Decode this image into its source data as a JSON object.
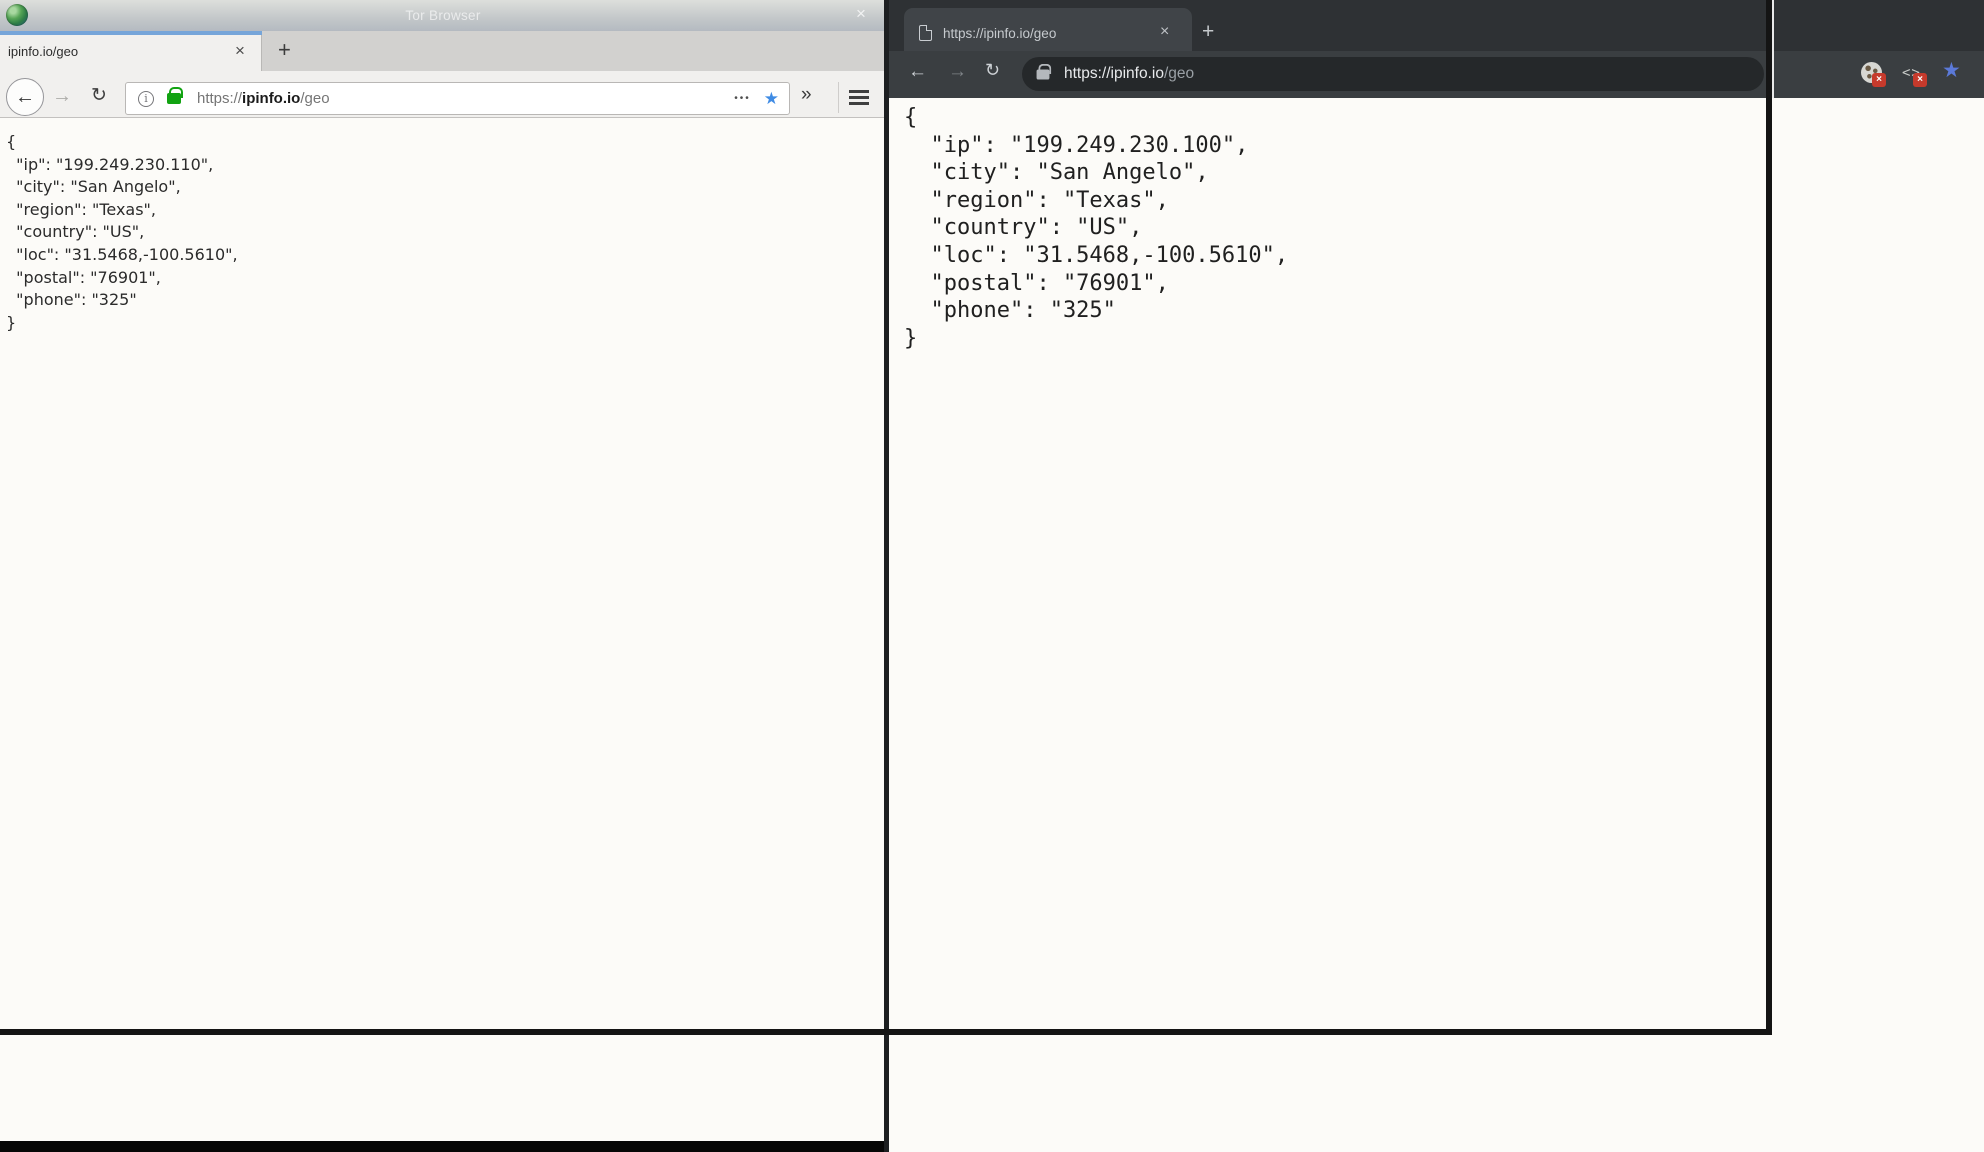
{
  "firefox": {
    "window_title": "Tor Browser",
    "titlebar_close": "×",
    "tab": {
      "title": "ipinfo.io/geo",
      "close": "×",
      "new_tab": "+"
    },
    "toolbar": {
      "back": "←",
      "forward": "→",
      "reload": "↻",
      "info_icon": "i",
      "url_scheme": "https://",
      "url_domain": "ipinfo.io",
      "url_path": "/geo",
      "page_actions": "•••",
      "bookmark_star": "★",
      "overflow": "»"
    },
    "content_json": [
      "{",
      "  \"ip\": \"199.249.230.110\",",
      "  \"city\": \"San Angelo\",",
      "  \"region\": \"Texas\",",
      "  \"country\": \"US\",",
      "  \"loc\": \"31.5468,-100.5610\",",
      "  \"postal\": \"76901\",",
      "  \"phone\": \"325\"",
      "}"
    ]
  },
  "chrome": {
    "tab": {
      "title": "https://ipinfo.io/geo",
      "close": "×",
      "new_tab": "+"
    },
    "toolbar": {
      "back": "←",
      "forward": "→",
      "reload": "↻",
      "url_secure": "https://ipinfo.io",
      "url_path": "/geo",
      "extension_badge": "×",
      "code_extension_glyph": "<>",
      "bookmark_star": "★"
    },
    "content_json": [
      "{",
      "  \"ip\": \"199.249.230.100\",",
      "  \"city\": \"San Angelo\",",
      "  \"region\": \"Texas\",",
      "  \"country\": \"US\",",
      "  \"loc\": \"31.5468,-100.5610\",",
      "  \"postal\": \"76901\",",
      "  \"phone\": \"325\"",
      "}"
    ]
  },
  "colors": {
    "ff_active_tab_accent": "#76a5d9",
    "ff_lock_green": "#12a312",
    "ff_star_blue": "#3f8be4",
    "cr_star_blue": "#5b79d8",
    "extension_badge_red": "#c63a2c",
    "frame_line_black": "#141414"
  }
}
